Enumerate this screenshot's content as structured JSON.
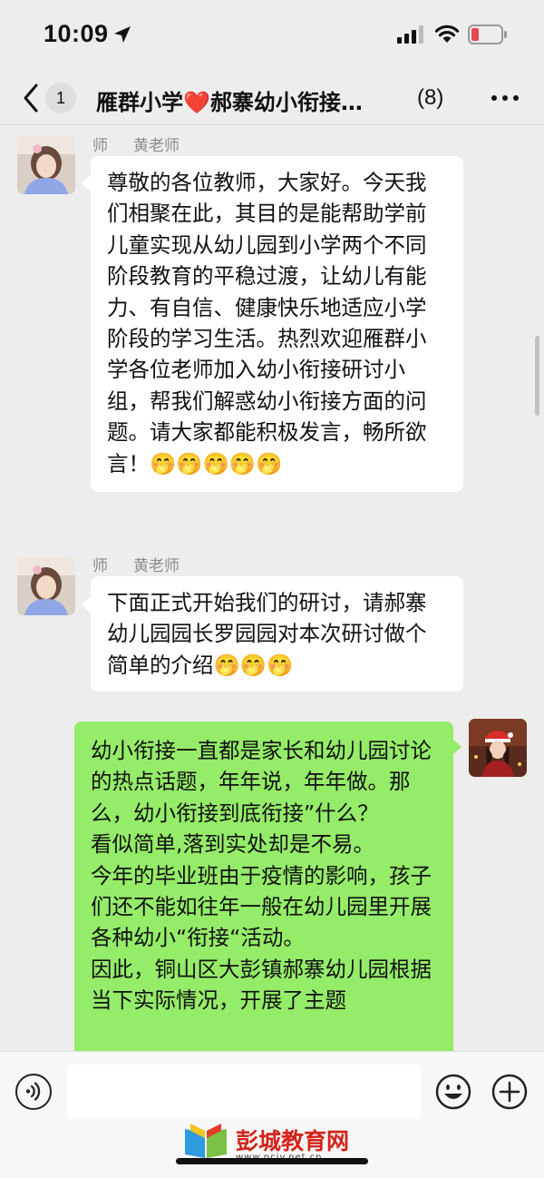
{
  "status_bar": {
    "time": "10:09",
    "battery_color": "#e5484d"
  },
  "header": {
    "back_count": "1",
    "title_part1": "雁群小学",
    "title_heart": "❤️",
    "title_part2": "郝寨幼小衔接…",
    "member_count": "(8)"
  },
  "messages": [
    {
      "side": "left",
      "sender_role": "师",
      "sender_name": "黄老师",
      "text": "尊敬的各位教师，大家好。今天我们相聚在此，其目的是能帮助学前儿童实现从幼儿园到小学两个不同阶段教育的平稳过渡，让幼儿有能力、有自信、健康快乐地适应小学阶段的学习生活。热烈欢迎雁群小学各位老师加入幼小衔接研讨小组，帮我们解惑幼小衔接方面的问题。请大家都能积极发言，畅所欲言！🤭🤭🤭🤭🤭"
    },
    {
      "side": "left",
      "sender_role": "师",
      "sender_name": "黄老师",
      "text": "下面正式开始我们的研讨，请郝寨幼儿园园长罗园园对本次研讨做个简单的介绍🤭🤭🤭"
    },
    {
      "side": "right",
      "text": "幼小衔接一直都是家长和幼儿园讨论的热点话题，年年说，年年做。那么，幼小衔接到底衔接”什么？\n看似简单,落到实处却是不易。\n今年的毕业班由于疫情的影响，孩子们还不能如往年一般在幼儿园里开展各种幼小“衔接“活动。\n因此，铜山区大彭镇郝寨幼儿园根据当下实际情况，开展了主题"
    }
  ],
  "input_bar": {
    "placeholder": ""
  },
  "icons": {
    "back": "chevron-left-icon",
    "more": "more-dots-icon",
    "voice": "voice-icon",
    "emoji": "emoji-icon",
    "plus": "plus-icon"
  },
  "watermark": {
    "text": "彭城教育网",
    "url": "www.pcjy.net.cn"
  },
  "colors": {
    "background": "#ededed",
    "bubble_self": "#95ec69",
    "bubble_other": "#ffffff",
    "heart": "#e5202e"
  }
}
